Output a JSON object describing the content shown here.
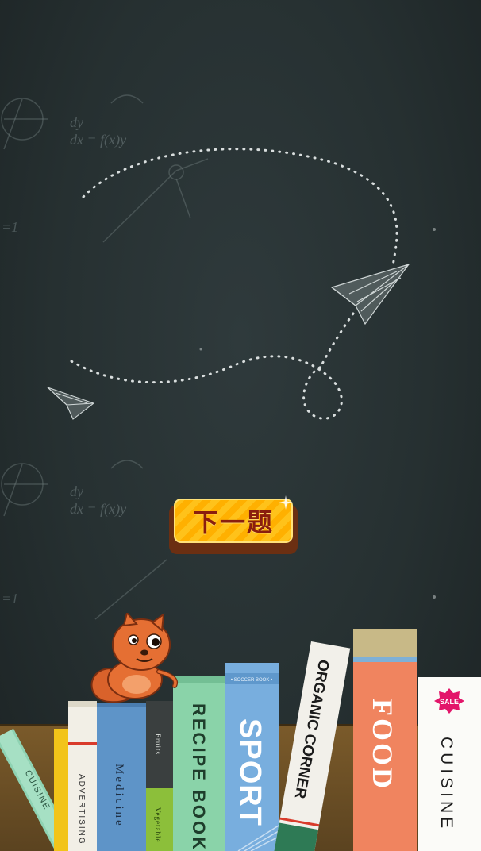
{
  "next_button": {
    "label": "下一题"
  },
  "chalkboard": {
    "doodle_text_top": "dy\ndx = f(x)y",
    "doodle_text_mid": "dy\ndx = f(x)y"
  },
  "books": {
    "cuisine_slant": "CUISINE",
    "advertising": "ADVERTISING",
    "medicine": "Medicine",
    "fruits": "Fruits",
    "vegetables": "Vegetable",
    "recipe_book": "RECIPE BOOK",
    "sport_small": "• SOCCER BOOK •",
    "sport": "SPORT",
    "organic_corner": "ORGANIC CORNER",
    "food": "FOOD",
    "sale_badge": "SALE",
    "cuisine": "CUISINE"
  },
  "colors": {
    "button": "#ffb800",
    "button_text": "#8a1e0e",
    "board": "#263031"
  }
}
